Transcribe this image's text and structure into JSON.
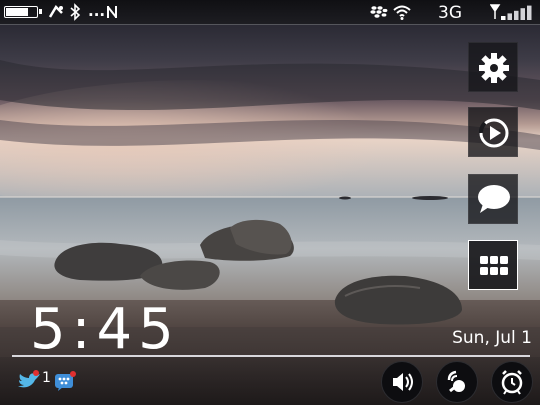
{
  "status_bar": {
    "battery_level": 0.75,
    "network": "3G",
    "signal_bars": 5,
    "ellipsis": "...",
    "icons": [
      "battery-icon",
      "rotation-icon",
      "bluetooth-icon",
      "more-icon",
      "nfc-icon",
      "blackberry-icon",
      "wifi-icon",
      "signal-icon"
    ]
  },
  "home": {
    "time": "5:45",
    "date": "Sun, Jul 1"
  },
  "side_buttons": [
    "settings-icon",
    "media-player-icon",
    "messages-icon",
    "all-apps-icon"
  ],
  "notifications": {
    "twitter_count": "1",
    "icons": [
      "twitter-icon",
      "bbm-icon"
    ]
  },
  "bottom_buttons": [
    "sound-icon",
    "connections-icon",
    "alarm-icon"
  ],
  "colors": {
    "accent": "#ffffff",
    "panel": "#141418",
    "status_bg": "#15151a"
  }
}
